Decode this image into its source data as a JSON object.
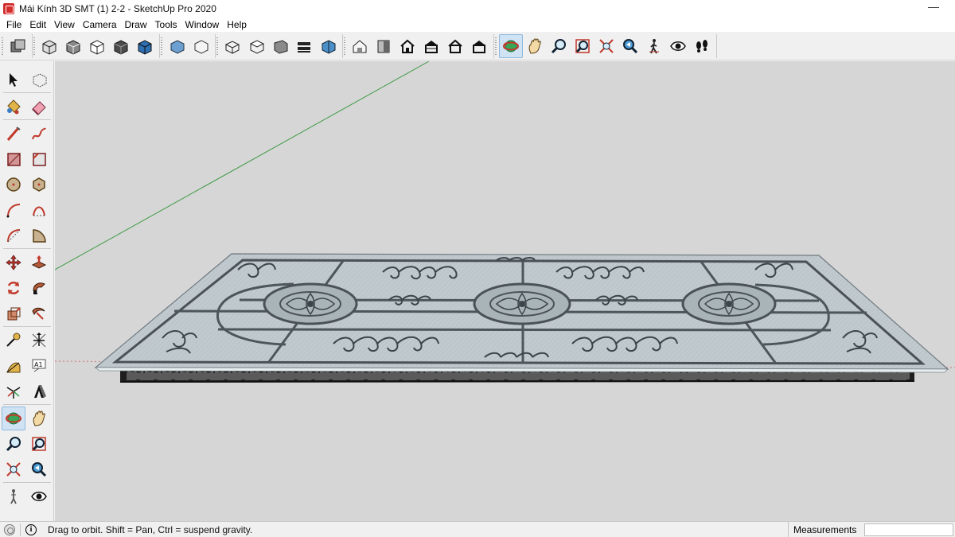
{
  "window": {
    "title": "Mái Kính 3D SMT (1) 2-2 - SketchUp Pro 2020",
    "minimize_glyph": "—"
  },
  "menu": [
    "File",
    "Edit",
    "View",
    "Camera",
    "Draw",
    "Tools",
    "Window",
    "Help"
  ],
  "toolbar_groups": [
    [
      "component-icon"
    ],
    [
      "xray-icon",
      "back-edges-icon",
      "wireframe-icon",
      "hidden-line-icon",
      "shaded-textures-icon"
    ],
    [
      "monochrome-icon",
      "shaded-icon"
    ],
    [
      "iso-view-icon",
      "top-view-icon",
      "front-view-icon",
      "right-view-icon",
      "section-view-icon"
    ],
    [
      "warehouse-icon",
      "extension-warehouse-icon",
      "house-icon",
      "house-section-icon",
      "house-front-icon",
      "house-back-icon"
    ],
    [
      "orbit-icon",
      "pan-icon",
      "zoom-icon",
      "zoom-window-icon",
      "zoom-extents-icon",
      "previous-view-icon",
      "walk-icon",
      "look-around-icon",
      "footprints-icon"
    ]
  ],
  "active_tool": "orbit-icon",
  "left_tools": [
    [
      "select-icon",
      "make-component-icon"
    ],
    [
      "paint-bucket-icon",
      "eraser-icon"
    ],
    [
      "line-icon",
      "freehand-icon"
    ],
    [
      "rectangle-icon",
      "rotated-rectangle-icon"
    ],
    [
      "circle-icon",
      "polygon-icon"
    ],
    [
      "arc-icon",
      "two-point-arc-icon"
    ],
    [
      "three-point-arc-icon",
      "pie-icon"
    ],
    [
      "move-icon",
      "push-pull-icon"
    ],
    [
      "rotate-icon",
      "follow-me-icon"
    ],
    [
      "scale-icon",
      "offset-icon"
    ],
    [
      "tape-measure-icon",
      "dimension-icon"
    ],
    [
      "protractor-icon",
      "text-icon"
    ],
    [
      "axes-icon",
      "3d-text-icon"
    ],
    [
      "orbit-icon",
      "pan-icon"
    ],
    [
      "zoom-icon",
      "zoom-window-icon"
    ],
    [
      "zoom-extents-icon",
      "previous-view-icon"
    ],
    [
      "position-camera-icon",
      "look-around-icon"
    ]
  ],
  "text_tool_label": "A1",
  "status": {
    "hint": "Drag to orbit. Shift = Pan, Ctrl = suspend gravity.",
    "measurements_label": "Measurements",
    "measurements_value": ""
  },
  "colors": {
    "viewport_bg": "#d6d6d6",
    "glass": "#b9c4c9",
    "iron": "#2d2d2d",
    "green_axis": "#3f9a45",
    "red_axis": "#d25b5b",
    "active_highlight": "#cfe3f5"
  }
}
